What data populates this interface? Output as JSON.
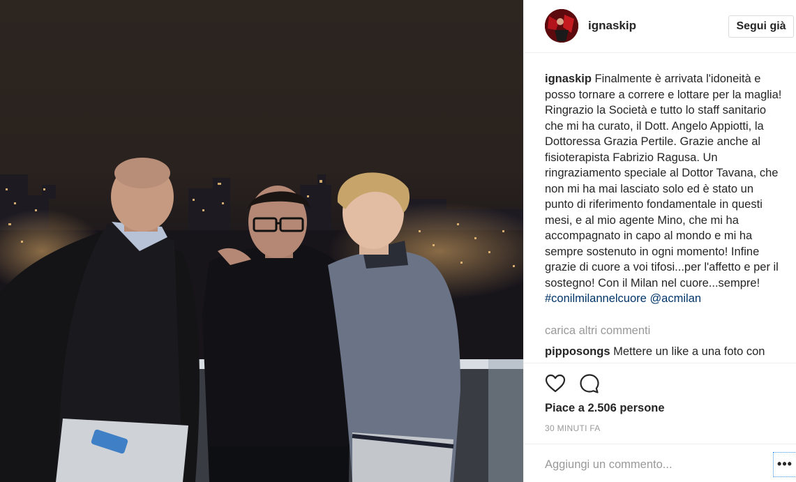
{
  "post": {
    "author": "ignaskip",
    "follow_label": "Segui già",
    "caption_user": "ignaskip",
    "caption_text": "Finalmente è arrivata l'idoneità e posso tornare a correre e lottare per la maglia! Ringrazio la Società e tutto lo staff sanitario che mi ha curato, il Dott. Angelo Appiotti, la Dottoressa Grazia Pertile. Grazie anche al fisioterapista Fabrizio Ragusa. Un ringraziamento speciale al Dottor Tavana, che non mi ha mai lasciato solo ed è stato un punto di riferimento fondamentale in questi mesi, e al mio agente Mino, che mi ha accompagnato in capo al mondo e mi ha sempre sostenuto in ogni momento! Infine grazie di cuore a voi tifosi...per l'affetto e per il sostegno! Con il Milan nel cuore...sempre!",
    "hashtag": "#conilmilannelcuore",
    "mention": "@acmilan",
    "load_more": "carica altri commenti",
    "comment_user": "pipposongs",
    "comment_text": "Mettere un like a una foto con",
    "likes": "Piace a 2.506 persone",
    "timestamp": "30 MINUTI FA",
    "add_comment_placeholder": "Aggiungi un commento...",
    "more_label": "•••"
  },
  "icons": {
    "like": "heart-outline-icon",
    "comment": "speech-bubble-icon",
    "more": "ellipsis-icon"
  },
  "colors": {
    "link": "#003569",
    "muted": "#999999",
    "text": "#262626",
    "border": "#efefef"
  }
}
